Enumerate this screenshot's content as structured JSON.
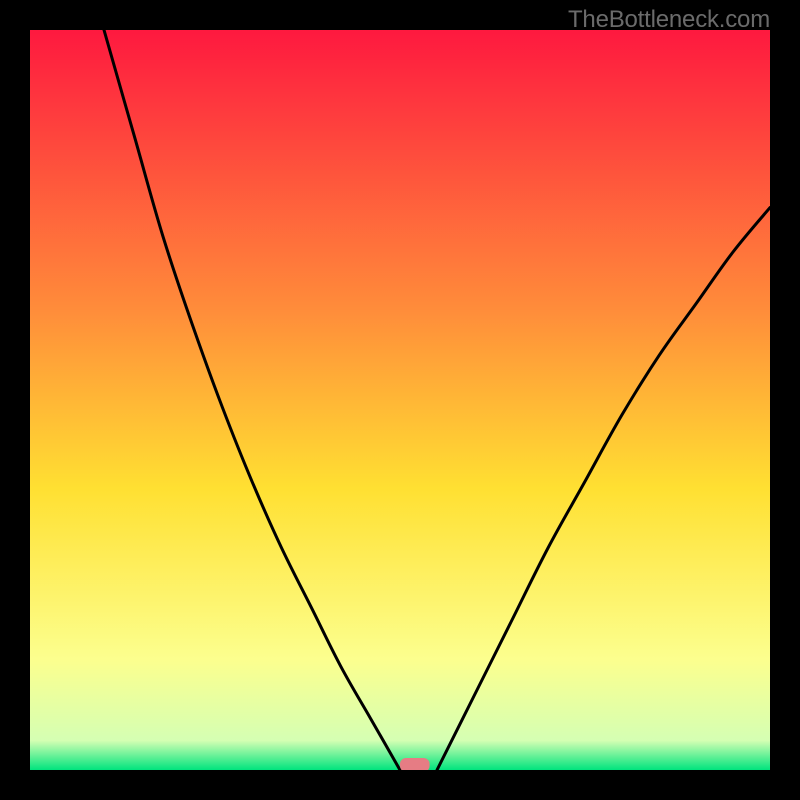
{
  "watermark": "TheBottleneck.com",
  "chart_data": {
    "type": "line",
    "title": "",
    "xlabel": "",
    "ylabel": "",
    "xlim": [
      0,
      100
    ],
    "ylim": [
      0,
      100
    ],
    "grid": false,
    "legend": false,
    "background_gradient": {
      "top": "#fe193f",
      "mid_upper": "#ff8d3a",
      "mid": "#ffe032",
      "mid_lower": "#fcff8e",
      "bottom": "#00e47e"
    },
    "series": [
      {
        "name": "left-arm",
        "x": [
          10,
          14,
          18,
          22,
          26,
          30,
          34,
          38,
          42,
          46,
          50
        ],
        "y": [
          100,
          86,
          72,
          60,
          49,
          39,
          30,
          22,
          14,
          7,
          0
        ]
      },
      {
        "name": "right-arm",
        "x": [
          55,
          60,
          65,
          70,
          75,
          80,
          85,
          90,
          95,
          100
        ],
        "y": [
          0,
          10,
          20,
          30,
          39,
          48,
          56,
          63,
          70,
          76
        ]
      }
    ],
    "marker": {
      "x": 52,
      "y": 0,
      "width_pct": 4,
      "color": "#e67c84"
    }
  }
}
